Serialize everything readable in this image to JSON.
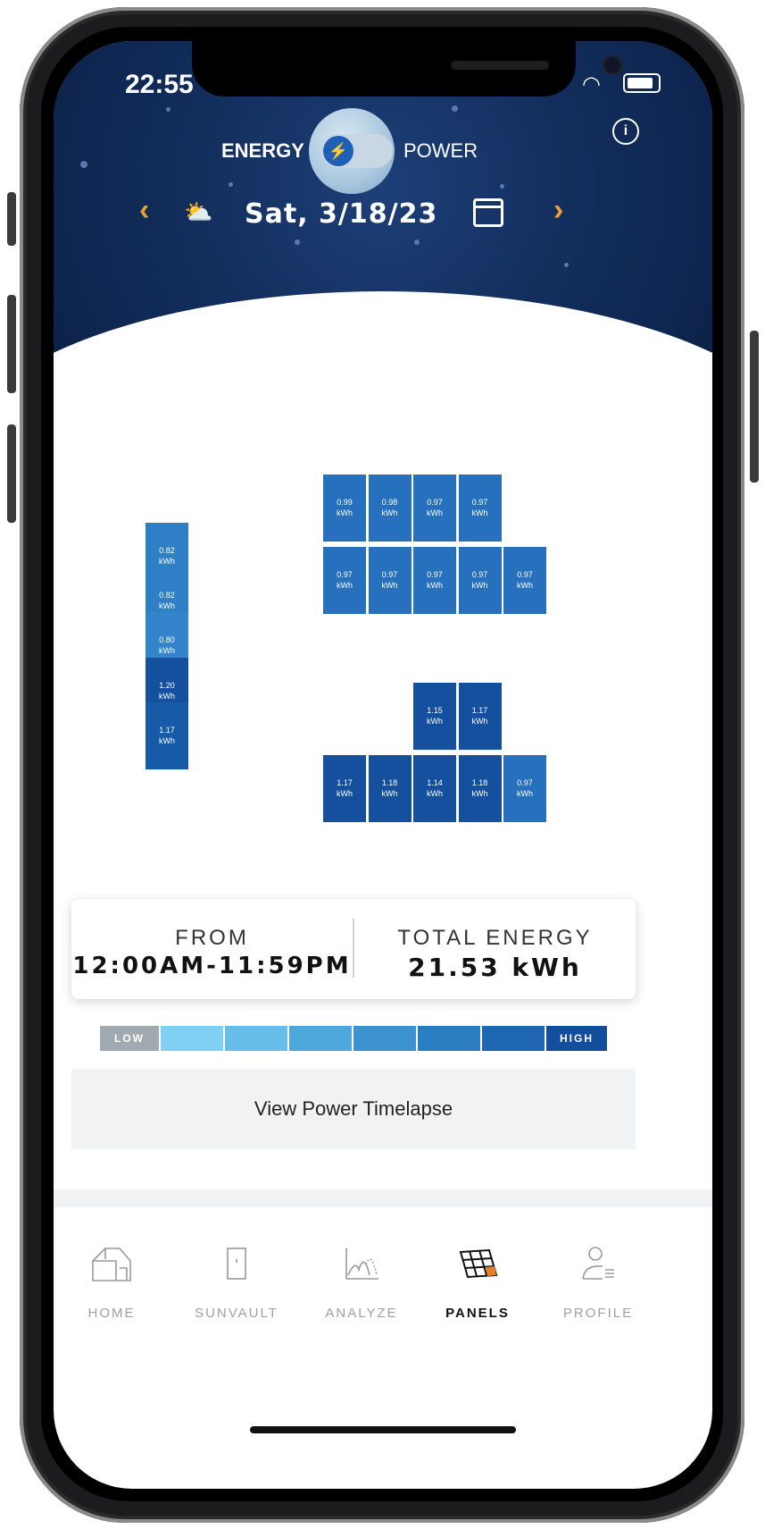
{
  "status_bar": {
    "time": "22:55"
  },
  "header": {
    "mode_left": "ENERGY",
    "mode_right": "POWER",
    "date": "Sat, 3/18/23",
    "info_icon": "info-icon",
    "weather_icon": "partly-cloudy-icon",
    "calendar_icon": "calendar-icon"
  },
  "panels": {
    "left_column": [
      "0.82 kWh",
      "0.82 kWh",
      "0.80 kWh",
      "1.20 kWh",
      "1.17 kWh"
    ],
    "top_row1": [
      "0.99 kWh",
      "0.98 kWh",
      "0.97 kWh",
      "0.97 kWh"
    ],
    "top_row2": [
      "0.97 kWh",
      "0.97 kWh",
      "0.97 kWh",
      "0.97 kWh",
      "0.97 kWh"
    ],
    "bottom_row1": [
      "1.15 kWh",
      "1.17 kWh"
    ],
    "bottom_row2": [
      "1.17 kWh",
      "1.18 kWh",
      "1.14 kWh",
      "1.18 kWh",
      "0.97 kWh"
    ],
    "unit": "kWh"
  },
  "summary": {
    "from_label": "FROM",
    "from_value": "12:00AM-11:59PM",
    "total_label": "TOTAL ENERGY",
    "total_value": "21.53 kWh"
  },
  "legend": {
    "low": "LOW",
    "high": "HIGH"
  },
  "timelapse_button": "View Power Timelapse",
  "tabs": [
    {
      "label": "HOME",
      "icon": "house-icon",
      "active": false
    },
    {
      "label": "SUNVAULT",
      "icon": "battery-cabinet-icon",
      "active": false
    },
    {
      "label": "ANALYZE",
      "icon": "chart-icon",
      "active": false
    },
    {
      "label": "PANELS",
      "icon": "solar-panel-icon",
      "active": true
    },
    {
      "label": "PROFILE",
      "icon": "user-icon",
      "active": false
    }
  ],
  "colors": {
    "header_bg": "#0f2a55",
    "accent_orange": "#f0a030",
    "panel_light": "#2f7fc6",
    "panel_dark": "#14509e"
  }
}
